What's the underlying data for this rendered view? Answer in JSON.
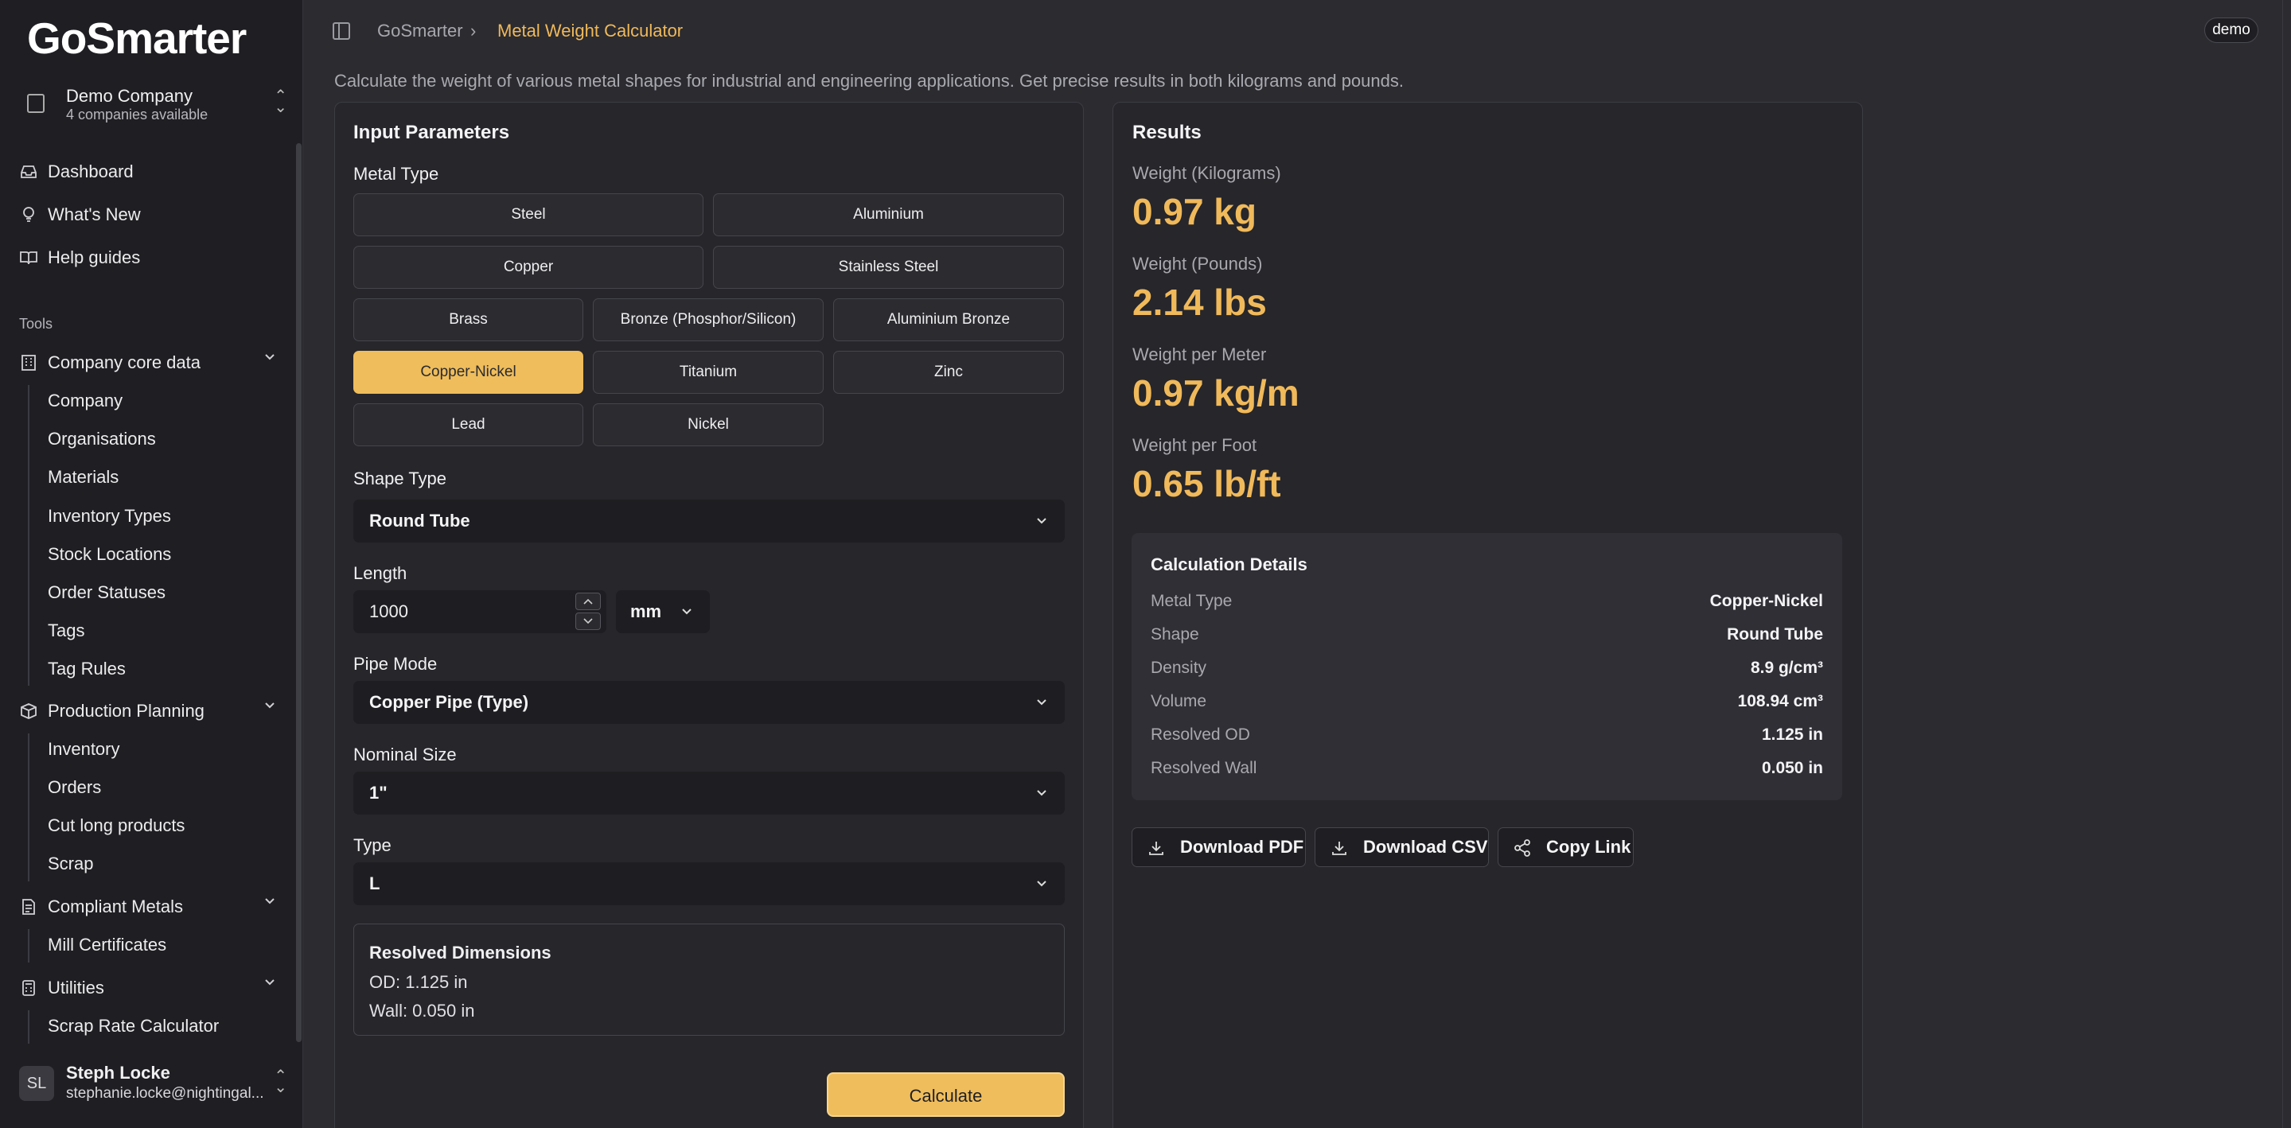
{
  "brand": {
    "logo_text_a": "Go",
    "logo_text_b": "Smarter"
  },
  "company": {
    "name": "Demo Company",
    "sub": "4 companies available"
  },
  "nav": {
    "dashboard": "Dashboard",
    "whats_new": "What's New",
    "help": "Help guides"
  },
  "tools_label": "Tools",
  "groups": {
    "core": {
      "label": "Company core data",
      "items": [
        "Company",
        "Organisations",
        "Materials",
        "Inventory Types",
        "Stock Locations",
        "Order Statuses",
        "Tags",
        "Tag Rules"
      ]
    },
    "production": {
      "label": "Production Planning",
      "items": [
        "Inventory",
        "Orders",
        "Cut long products",
        "Scrap"
      ]
    },
    "compliant": {
      "label": "Compliant Metals",
      "items": [
        "Mill Certificates"
      ]
    },
    "utilities": {
      "label": "Utilities",
      "items": [
        "Scrap Rate Calculator"
      ]
    }
  },
  "user": {
    "initials": "SL",
    "name": "Steph Locke",
    "email": "stephanie.locke@nightingal..."
  },
  "header": {
    "crumb_root": "GoSmarter",
    "crumb_sep": "›",
    "crumb_current": "Metal Weight Calculator",
    "badge": "demo"
  },
  "description": "Calculate the weight of various metal shapes for industrial and engineering applications. Get precise results in both kilograms and pounds.",
  "inputs": {
    "title": "Input Parameters",
    "metal_type_label": "Metal Type",
    "metals": [
      "Steel",
      "Aluminium",
      "Copper",
      "Stainless Steel",
      "Brass",
      "Bronze (Phosphor/Silicon)",
      "Aluminium Bronze",
      "Copper-Nickel",
      "Titanium",
      "Zinc",
      "Lead",
      "Nickel"
    ],
    "selected_metal": "Copper-Nickel",
    "shape_label": "Shape Type",
    "shape_value": "Round Tube",
    "length_label": "Length",
    "length_value": "1000",
    "length_unit": "mm",
    "pipe_mode_label": "Pipe Mode",
    "pipe_mode_value": "Copper Pipe (Type)",
    "nominal_label": "Nominal Size",
    "nominal_value": "1\"",
    "type_label": "Type",
    "type_value": "L",
    "resolved_title": "Resolved Dimensions",
    "resolved_od": "OD: 1.125 in",
    "resolved_wall": "Wall: 0.050 in",
    "calculate_label": "Calculate"
  },
  "results": {
    "title": "Results",
    "kg_label": "Weight (Kilograms)",
    "kg_value": "0.97 kg",
    "lbs_label": "Weight (Pounds)",
    "lbs_value": "2.14 lbs",
    "kgm_label": "Weight per Meter",
    "kgm_value": "0.97 kg/m",
    "lbft_label": "Weight per Foot",
    "lbft_value": "0.65 lb/ft",
    "details_title": "Calculation Details",
    "details": [
      {
        "k": "Metal Type",
        "v": "Copper-Nickel"
      },
      {
        "k": "Shape",
        "v": "Round Tube"
      },
      {
        "k": "Density",
        "v": "8.9 g/cm³"
      },
      {
        "k": "Volume",
        "v": "108.94 cm³"
      },
      {
        "k": "Resolved OD",
        "v": "1.125 in"
      },
      {
        "k": "Resolved Wall",
        "v": "0.050 in"
      }
    ],
    "actions": {
      "pdf": "Download PDF",
      "csv": "Download CSV",
      "link": "Copy Link"
    }
  },
  "colors": {
    "accent": "#efbd5c",
    "background": "#2b2b30",
    "sidebar": "#1f1f23"
  }
}
